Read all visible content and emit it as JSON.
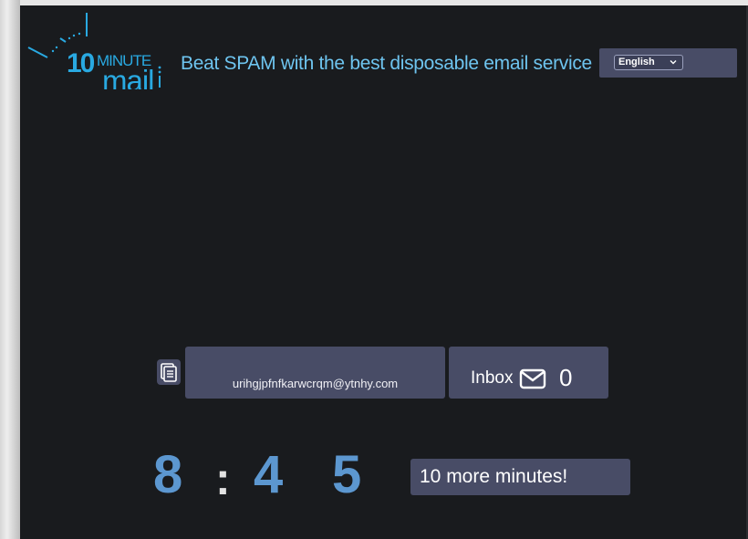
{
  "header": {
    "logo": {
      "text_number": "10",
      "text_minute": "MINUTE",
      "text_mail": "mail"
    },
    "tagline": "Beat SPAM with the best disposable email service"
  },
  "language": {
    "selected": "English"
  },
  "email": {
    "address": "urihgjpfnfkarwcrqm@ytnhy.com"
  },
  "inbox": {
    "label": "Inbox",
    "count": "0"
  },
  "timer": {
    "minutes": "8",
    "separator": ":",
    "tens": "4",
    "ones": "5"
  },
  "extend_button": {
    "label": "10 more minutes!"
  },
  "colors": {
    "accent": "#6ec4ef",
    "logo_blue": "#29a9e1",
    "timer_blue": "#5c97d0",
    "panel": "#484c66",
    "background": "#191b1e"
  },
  "icons": {
    "copy": "copy-document-icon",
    "mail": "envelope-icon",
    "dropdown": "chevron-down-icon"
  }
}
